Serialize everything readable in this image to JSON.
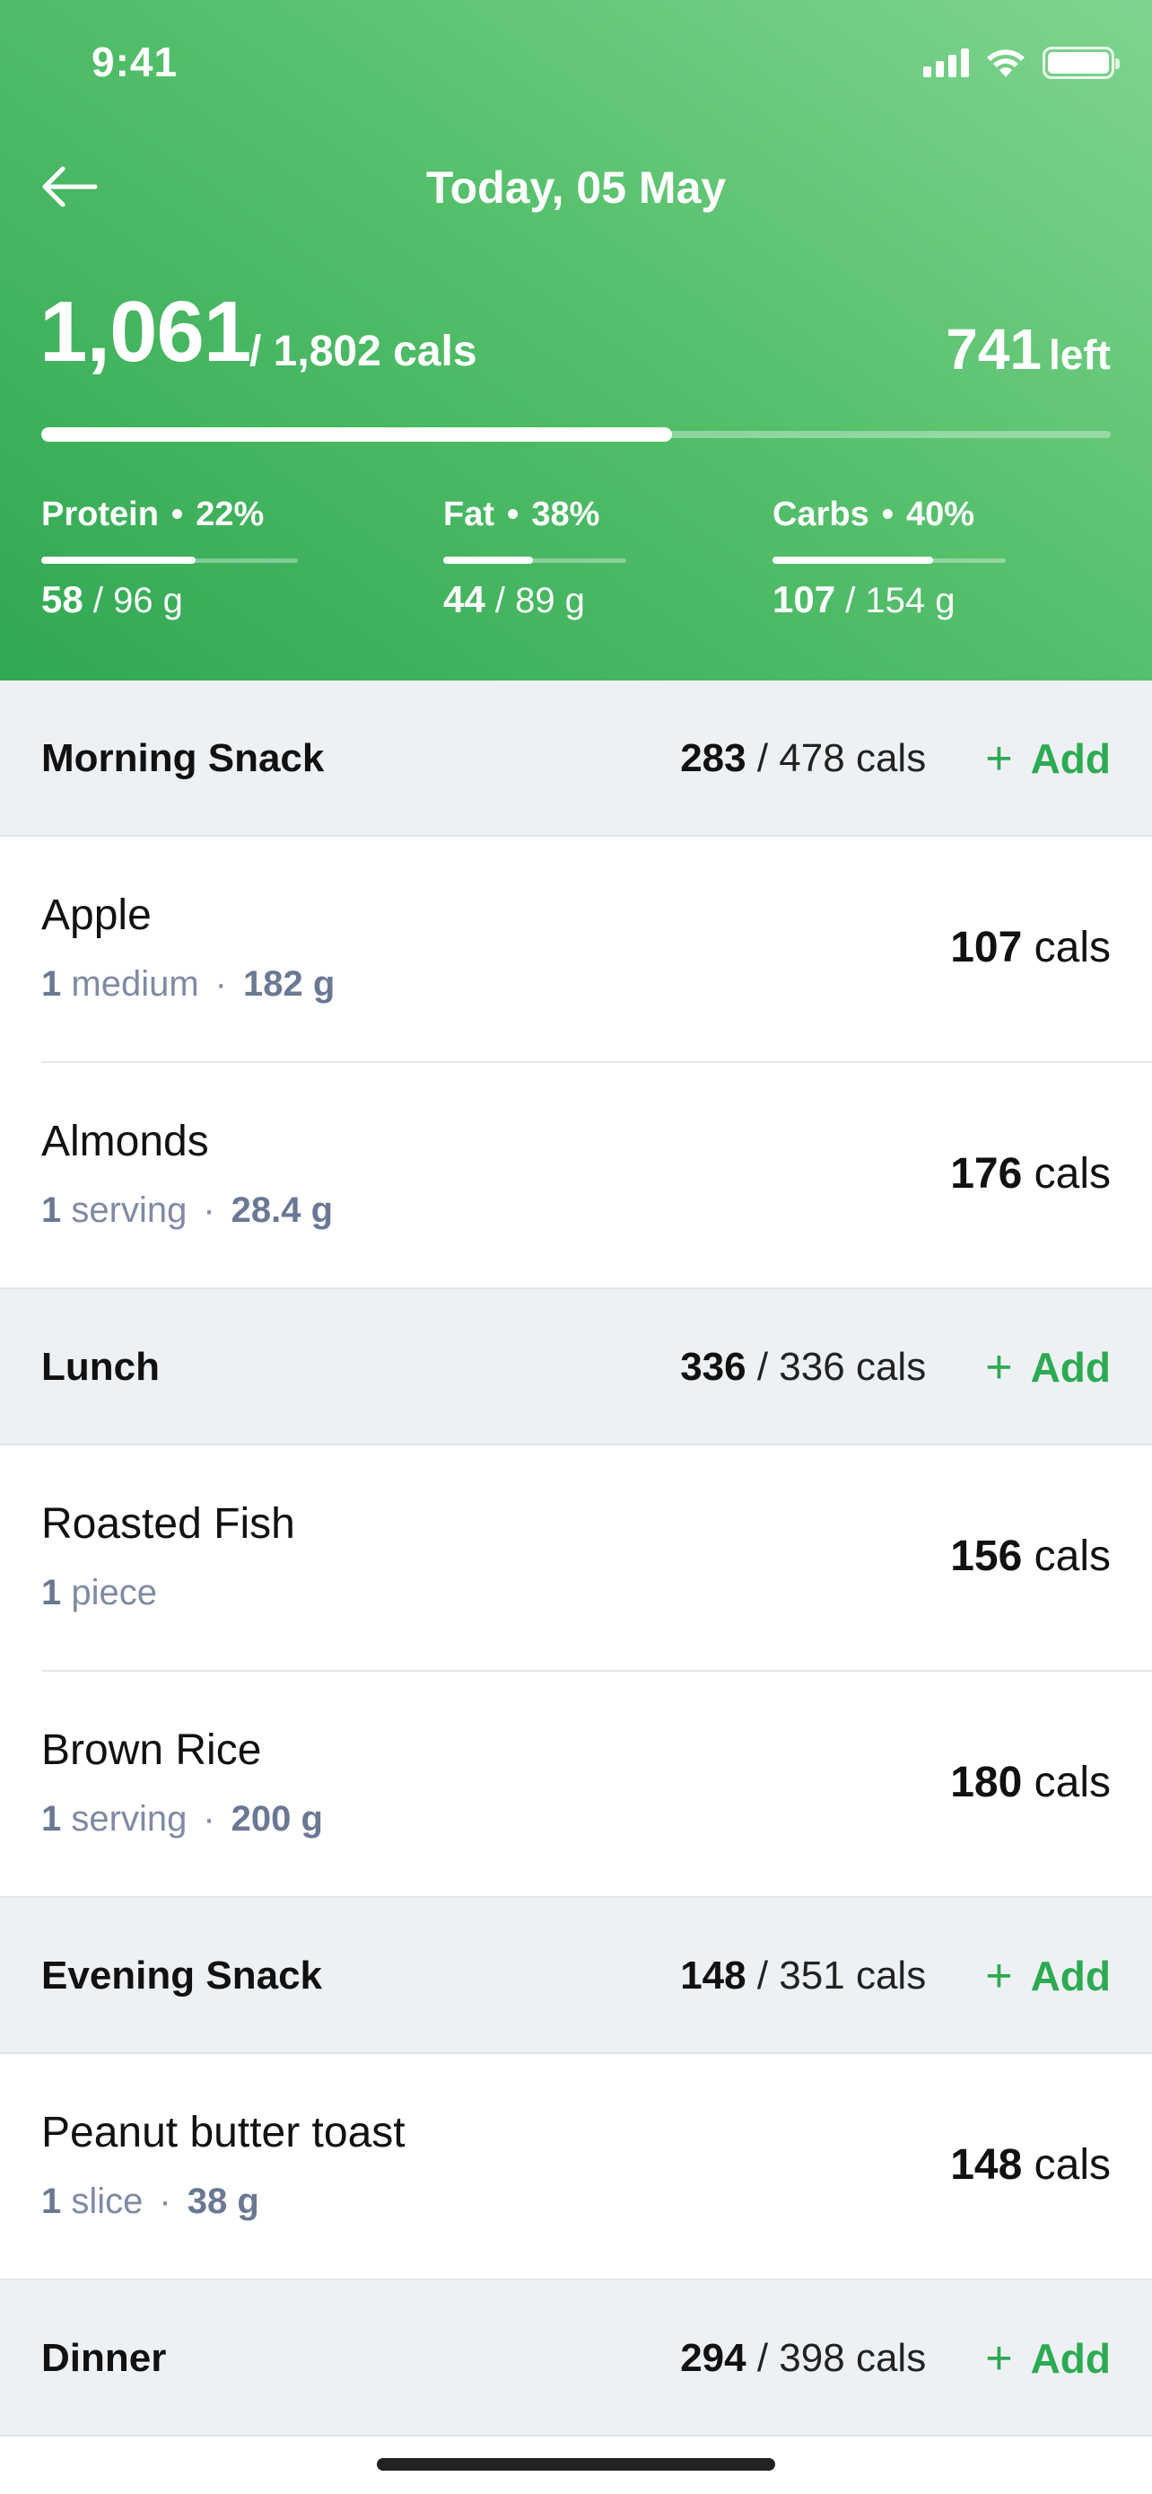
{
  "status_bar": {
    "time": "9:41"
  },
  "nav": {
    "title": "Today, 05 May"
  },
  "summary": {
    "consumed": "1,061",
    "total": "/  1,802 cals",
    "left_value": "741",
    "left_label": "left",
    "progress": 0.59
  },
  "macros": [
    {
      "name": "Protein",
      "percent": "22%",
      "value": "58",
      "target": "/ 96 g",
      "progress": 0.6
    },
    {
      "name": "Fat",
      "percent": "38%",
      "value": "44",
      "target": "/ 89 g",
      "progress": 0.49
    },
    {
      "name": "Carbs",
      "percent": "40%",
      "value": "107",
      "target": "/ 154 g",
      "progress": 0.69
    }
  ],
  "meals": [
    {
      "name": "Morning Snack",
      "consumed": "283",
      "target": "/ 478 cals",
      "add_label": "Add",
      "items": [
        {
          "name": "Apple",
          "qty": "1",
          "unit": "medium",
          "weight": "182 g",
          "cals": "107",
          "cals_unit": "cals"
        },
        {
          "name": "Almonds",
          "qty": "1",
          "unit": "serving",
          "weight": "28.4 g",
          "cals": "176",
          "cals_unit": "cals"
        }
      ]
    },
    {
      "name": "Lunch",
      "consumed": "336",
      "target": "/ 336 cals",
      "add_label": "Add",
      "items": [
        {
          "name": "Roasted Fish",
          "qty": "1",
          "unit": "piece",
          "cals": "156",
          "cals_unit": "cals"
        },
        {
          "name": "Brown Rice",
          "qty": "1",
          "unit": "serving",
          "weight": "200 g",
          "cals": "180",
          "cals_unit": "cals"
        }
      ]
    },
    {
      "name": "Evening Snack",
      "consumed": "148",
      "target": "/ 351 cals",
      "add_label": "Add",
      "items": [
        {
          "name": "Peanut butter toast",
          "qty": "1",
          "unit": "slice",
          "weight": "38 g",
          "cals": "148",
          "cals_unit": "cals"
        }
      ]
    },
    {
      "name": "Dinner",
      "consumed": "294",
      "target": "/ 398 cals",
      "add_label": "Add",
      "items": []
    }
  ],
  "colors": {
    "accent": "#2daa52",
    "header_top": "#7fd58f",
    "header_bottom": "#31a852",
    "section_bg": "#eef1f4",
    "meta_text": "#7f8aa3"
  },
  "icons": [
    "wifi-icon",
    "cellular-signal-icon",
    "battery-icon",
    "back-arrow-icon",
    "plus-icon"
  ]
}
